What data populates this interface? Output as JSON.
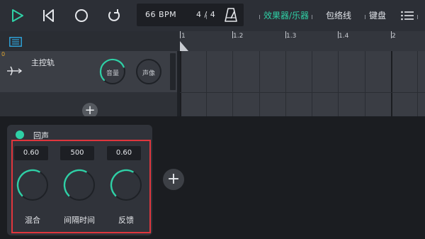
{
  "toolbar": {
    "play_icon": "play-icon",
    "rewind_icon": "skip-to-start-icon",
    "record_icon": "record-icon",
    "loop_icon": "loop-icon",
    "bpm": "66 BPM",
    "time_signature": "4 / 4",
    "metronome_icon": "metronome-icon",
    "tabs": [
      {
        "label": "效果器/乐器",
        "active": true
      },
      {
        "label": "包络线",
        "active": false
      },
      {
        "label": "键盘",
        "active": false
      }
    ],
    "menu_icon": "hamburger-menu-icon",
    "accent_color": "#2fd0a6"
  },
  "timeline": {
    "ruler_labels": [
      "1",
      "1.2",
      "1.3",
      "1.4",
      "2"
    ]
  },
  "track": {
    "index": "0",
    "name": "主控轨",
    "icon": "split-output-icon",
    "volume_label": "音量",
    "pan_label": "声像",
    "volume_level": 0.75
  },
  "effect": {
    "name": "回声",
    "enabled_color": "#2fd0a6",
    "params": [
      {
        "value": "0.60",
        "label": "混合",
        "level": 0.6
      },
      {
        "value": "500",
        "label": "间隔时间",
        "level": 0.6
      },
      {
        "value": "0.60",
        "label": "反馈",
        "level": 0.6
      }
    ]
  },
  "highlight_color": "#e0363d"
}
